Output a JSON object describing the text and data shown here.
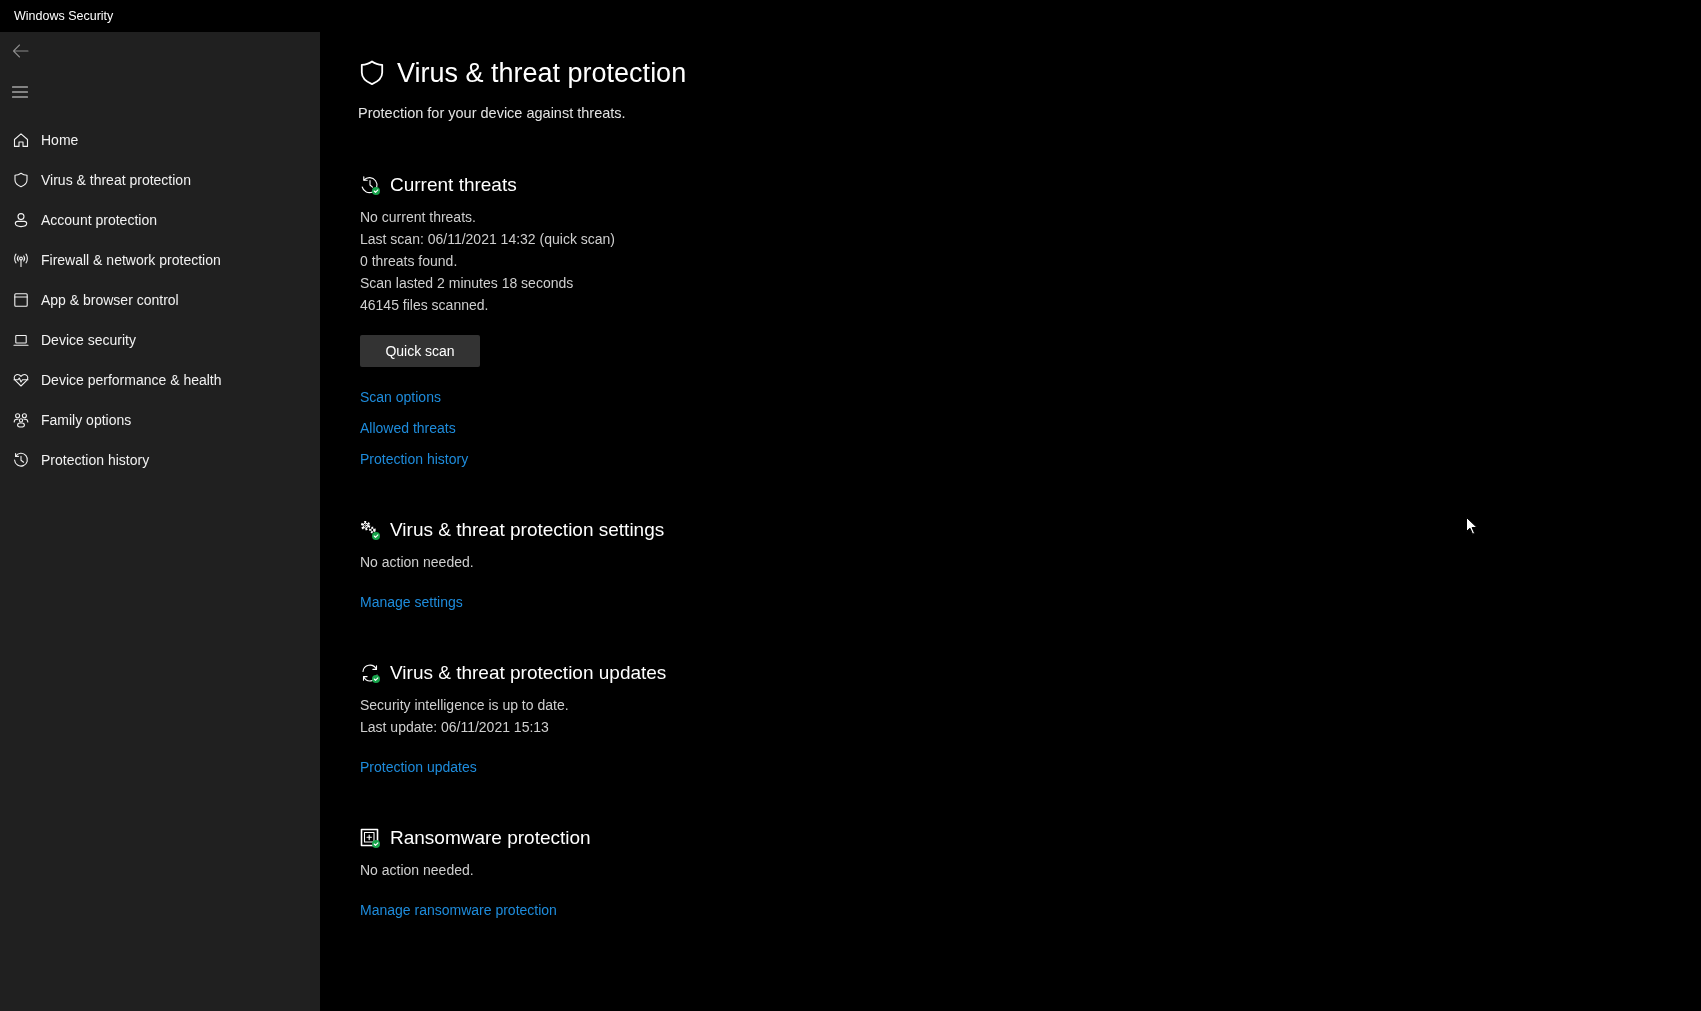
{
  "window": {
    "title": "Windows Security"
  },
  "sidebar": {
    "items": [
      "Home",
      "Virus & threat protection",
      "Account protection",
      "Firewall & network protection",
      "App & browser control",
      "Device security",
      "Device performance & health",
      "Family options",
      "Protection history"
    ]
  },
  "page": {
    "title": "Virus & threat protection",
    "subtitle": "Protection for your device against threats."
  },
  "sections": [
    {
      "title": "Current threats",
      "lines": [
        "No current threats.",
        "Last scan: 06/11/2021 14:32 (quick scan)",
        "0 threats found.",
        "Scan lasted 2 minutes 18 seconds",
        "46145 files scanned."
      ],
      "button": "Quick scan",
      "links": [
        "Scan options",
        "Allowed threats",
        "Protection history"
      ]
    },
    {
      "title": "Virus & threat protection settings",
      "lines": [
        "No action needed."
      ],
      "links": [
        "Manage settings"
      ]
    },
    {
      "title": "Virus & threat protection updates",
      "lines": [
        "Security intelligence is up to date.",
        "Last update: 06/11/2021 15:13"
      ],
      "links": [
        "Protection updates"
      ]
    },
    {
      "title": "Ransomware protection",
      "lines": [
        "No action needed."
      ],
      "links": [
        "Manage ransomware protection"
      ]
    }
  ]
}
